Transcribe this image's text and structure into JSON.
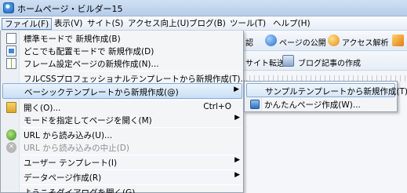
{
  "window": {
    "title": "ホームページ・ビルダー15"
  },
  "menubar": [
    "ファイル(F)",
    "表示(V)",
    "サイト(S)",
    "アクセス向上(U)",
    "ブログ(B)",
    "ツール(T)",
    "ヘルプ(H)"
  ],
  "toolbar": {
    "partial_1": "認",
    "publish": "ページの公開",
    "analytics": "アクセス解析",
    "site_transfer": "サイト転送",
    "blog_article": "ブログ記事の作成"
  },
  "file_menu": {
    "items": [
      {
        "label": "標準モードで 新規作成(B)"
      },
      {
        "label": "どこでも配置モードで 新規作成(D)"
      },
      {
        "label": "フレーム設定ページの新規作成(N)..."
      },
      {
        "label": "フルCSSプロフェッショナルテンプレートから新規作成(T)..."
      },
      {
        "label": "ベーシックテンプレートから新規作成(@)"
      },
      {
        "label": "開く(O)...",
        "shortcut": "Ctrl+O"
      },
      {
        "label": "モードを指定してページを開く(M)"
      },
      {
        "label": "URL から読み込み(U)..."
      },
      {
        "label": "URL から読み込みの中止(D)"
      },
      {
        "label": "ユーザー テンプレート(I)"
      },
      {
        "label": "データページ作成(R)"
      },
      {
        "label": "ようこそダイアログを開く(G)"
      }
    ]
  },
  "submenu": {
    "items": [
      {
        "label": "サンプルテンプレートから新規作成(T)..."
      },
      {
        "label": "かんたんページ作成(W)..."
      }
    ]
  },
  "colors": {
    "highlight": "#c9def5",
    "menu_bg": "#f4f5f7",
    "titlebar": "#b6cde9"
  }
}
